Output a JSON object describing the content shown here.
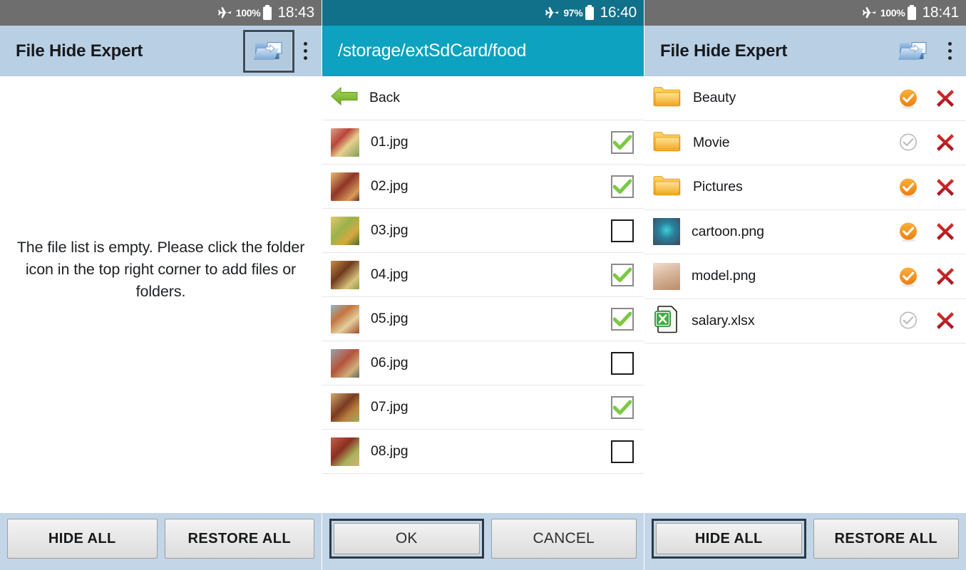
{
  "panels": [
    {
      "id": "main-empty",
      "statusbar": {
        "airplane_icon": "airplane-icon",
        "battery_pct": "100%",
        "battery_icon": "battery-icon",
        "time": "18:43",
        "theme": "gray"
      },
      "appbar": {
        "type": "title",
        "title": "File Hide Expert",
        "folder_icon": "add-folder-icon",
        "folder_focused": true,
        "overflow_icon": "overflow-menu-icon",
        "theme": "blue"
      },
      "empty_message": "The file list is empty. Please click the folder icon in the top right corner to add files or folders.",
      "rows": [],
      "buttons": [
        {
          "label": "HIDE ALL",
          "focused": false,
          "style": "bold"
        },
        {
          "label": "RESTORE ALL",
          "focused": false,
          "style": "bold"
        }
      ]
    },
    {
      "id": "file-picker",
      "statusbar": {
        "airplane_icon": "airplane-icon",
        "battery_pct": "97%",
        "battery_icon": "battery-icon",
        "time": "16:40",
        "theme": "teal"
      },
      "appbar": {
        "type": "path",
        "path": "/storage/extSdCard/food",
        "theme": "cyan"
      },
      "empty_message": "",
      "rows": [
        {
          "kind": "back",
          "icon": "back-arrow-icon",
          "name": "Back"
        },
        {
          "kind": "file",
          "icon": "image-thumbnail",
          "name": "01.jpg",
          "checked": true
        },
        {
          "kind": "file",
          "icon": "image-thumbnail",
          "name": "02.jpg",
          "checked": true
        },
        {
          "kind": "file",
          "icon": "image-thumbnail",
          "name": "03.jpg",
          "checked": false
        },
        {
          "kind": "file",
          "icon": "image-thumbnail",
          "name": "04.jpg",
          "checked": true
        },
        {
          "kind": "file",
          "icon": "image-thumbnail",
          "name": "05.jpg",
          "checked": true
        },
        {
          "kind": "file",
          "icon": "image-thumbnail",
          "name": "06.jpg",
          "checked": false
        },
        {
          "kind": "file",
          "icon": "image-thumbnail",
          "name": "07.jpg",
          "checked": true
        },
        {
          "kind": "file",
          "icon": "image-thumbnail",
          "name": "08.jpg",
          "checked": false
        }
      ],
      "buttons": [
        {
          "label": "OK",
          "focused": true,
          "style": "thin"
        },
        {
          "label": "CANCEL",
          "focused": false,
          "style": "thin"
        }
      ]
    },
    {
      "id": "hidden-list",
      "statusbar": {
        "airplane_icon": "airplane-icon",
        "battery_pct": "100%",
        "battery_icon": "battery-icon",
        "time": "18:41",
        "theme": "gray"
      },
      "appbar": {
        "type": "title",
        "title": "File Hide Expert",
        "folder_icon": "add-folder-icon",
        "folder_focused": false,
        "overflow_icon": "overflow-menu-icon",
        "theme": "blue"
      },
      "empty_message": "",
      "rows": [
        {
          "kind": "entry",
          "icon": "folder-icon",
          "name": "Beauty",
          "hidden": true,
          "remove_icon": "remove-x-icon"
        },
        {
          "kind": "entry",
          "icon": "folder-icon",
          "name": "Movie",
          "hidden": false,
          "remove_icon": "remove-x-icon"
        },
        {
          "kind": "entry",
          "icon": "folder-icon",
          "name": "Pictures",
          "hidden": true,
          "remove_icon": "remove-x-icon"
        },
        {
          "kind": "entry",
          "icon": "image-thumbnail",
          "name": "cartoon.png",
          "hidden": true,
          "remove_icon": "remove-x-icon"
        },
        {
          "kind": "entry",
          "icon": "image-thumbnail",
          "name": "model.png",
          "hidden": true,
          "remove_icon": "remove-x-icon"
        },
        {
          "kind": "entry",
          "icon": "excel-file-icon",
          "name": "salary.xlsx",
          "hidden": false,
          "remove_icon": "remove-x-icon"
        }
      ],
      "buttons": [
        {
          "label": "HIDE ALL",
          "focused": true,
          "style": "bold"
        },
        {
          "label": "RESTORE ALL",
          "focused": false,
          "style": "bold"
        }
      ]
    }
  ],
  "colors": {
    "statusbar_gray": "#6e6e6e",
    "statusbar_teal": "#11708a",
    "appbar_blue": "#b9cfe4",
    "appbar_cyan": "#0ca2c0",
    "bottombar": "#c2d6e8",
    "hidden_on": "#f08a16",
    "hidden_off": "#bdbdbd",
    "remove_red": "#c41f22",
    "check_green": "#7ac943",
    "folder_yellow": "#f5b731"
  }
}
